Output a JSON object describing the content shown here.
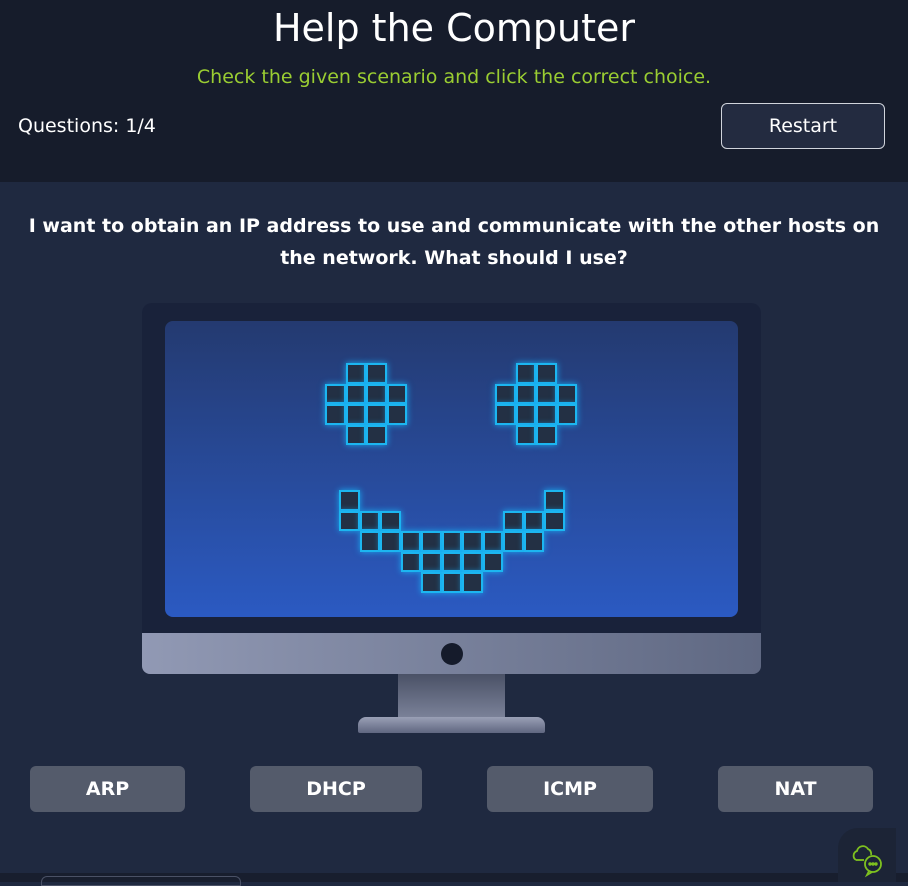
{
  "header": {
    "title": "Help the Computer",
    "subtitle": "Check the given scenario and click the correct choice.",
    "question_count": "Questions: 1/4",
    "restart_label": "Restart"
  },
  "question": "I want to obtain an IP address to use and communicate with the other hosts on the network. What should I use?",
  "face": {
    "eye": [
      "0110",
      "1111",
      "1111",
      "0110"
    ],
    "mouth": [
      "10000000001",
      "11100000111",
      "01111111110",
      "00011111000",
      "00001110000"
    ],
    "glow_color": "#1cb6f0"
  },
  "options": [
    {
      "label": "ARP"
    },
    {
      "label": "DHCP"
    },
    {
      "label": "ICMP"
    },
    {
      "label": "NAT"
    }
  ],
  "colors": {
    "accent": "#9acd32",
    "button": "#545b6b",
    "background": "#1f2940"
  },
  "chat_icon": "chat-bubbles-icon"
}
